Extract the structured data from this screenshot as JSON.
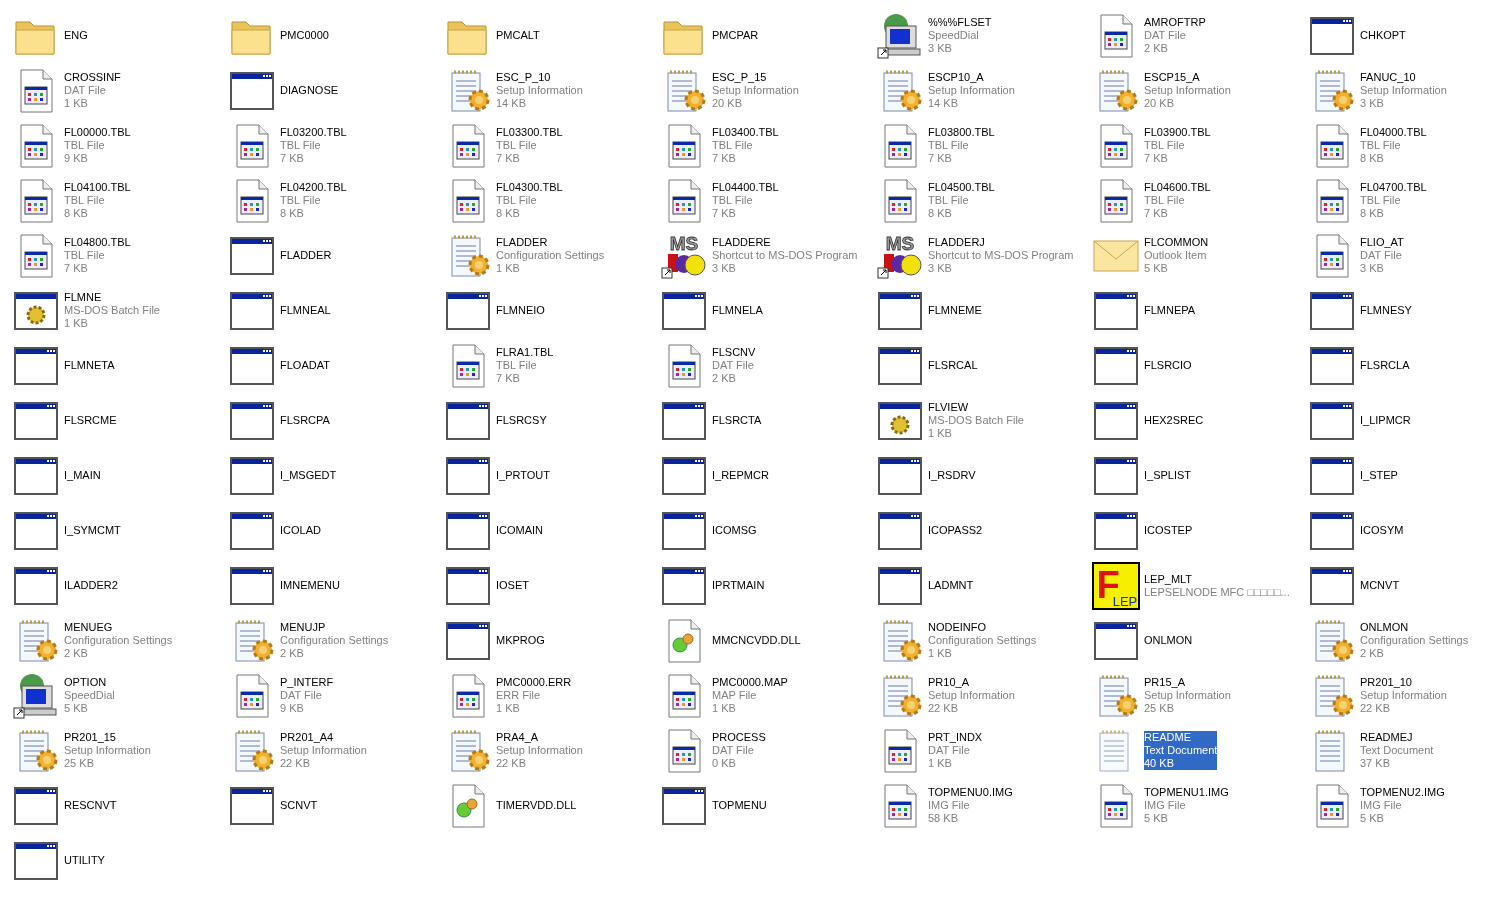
{
  "files": [
    {
      "name": "ENG",
      "kind": "folder",
      "selected": false
    },
    {
      "name": "PMC0000",
      "kind": "folder",
      "selected": false
    },
    {
      "name": "PMCALT",
      "kind": "folder",
      "selected": false
    },
    {
      "name": "PMCPAR",
      "kind": "folder",
      "selected": false
    },
    {
      "name": "%%%FLSET",
      "type": "SpeedDial",
      "size": "3 KB",
      "kind": "speeddial",
      "selected": false
    },
    {
      "name": "AMROFTRP",
      "type": "DAT File",
      "size": "2 KB",
      "kind": "datfile",
      "selected": false
    },
    {
      "name": "CHKOPT",
      "kind": "window",
      "selected": false
    },
    {
      "name": "CROSSINF",
      "type": "DAT File",
      "size": "1 KB",
      "kind": "datfile",
      "selected": false
    },
    {
      "name": "DIAGNOSE",
      "kind": "window",
      "selected": false
    },
    {
      "name": "ESC_P_10",
      "type": "Setup Information",
      "size": "14 KB",
      "kind": "setup",
      "selected": false
    },
    {
      "name": "ESC_P_15",
      "type": "Setup Information",
      "size": "20 KB",
      "kind": "setup",
      "selected": false
    },
    {
      "name": "ESCP10_A",
      "type": "Setup Information",
      "size": "14 KB",
      "kind": "setup",
      "selected": false
    },
    {
      "name": "ESCP15_A",
      "type": "Setup Information",
      "size": "20 KB",
      "kind": "setup",
      "selected": false
    },
    {
      "name": "FANUC_10",
      "type": "Setup Information",
      "size": "3 KB",
      "kind": "setup",
      "selected": false
    },
    {
      "name": "FL00000.TBL",
      "type": "TBL File",
      "size": "9 KB",
      "kind": "datfile",
      "selected": false
    },
    {
      "name": "FL03200.TBL",
      "type": "TBL File",
      "size": "7 KB",
      "kind": "datfile",
      "selected": false
    },
    {
      "name": "FL03300.TBL",
      "type": "TBL File",
      "size": "7 KB",
      "kind": "datfile",
      "selected": false
    },
    {
      "name": "FL03400.TBL",
      "type": "TBL File",
      "size": "7 KB",
      "kind": "datfile",
      "selected": false
    },
    {
      "name": "FL03800.TBL",
      "type": "TBL File",
      "size": "7 KB",
      "kind": "datfile",
      "selected": false
    },
    {
      "name": "FL03900.TBL",
      "type": "TBL File",
      "size": "7 KB",
      "kind": "datfile",
      "selected": false
    },
    {
      "name": "FL04000.TBL",
      "type": "TBL File",
      "size": "8 KB",
      "kind": "datfile",
      "selected": false
    },
    {
      "name": "FL04100.TBL",
      "type": "TBL File",
      "size": "8 KB",
      "kind": "datfile",
      "selected": false
    },
    {
      "name": "FL04200.TBL",
      "type": "TBL File",
      "size": "8 KB",
      "kind": "datfile",
      "selected": false
    },
    {
      "name": "FL04300.TBL",
      "type": "TBL File",
      "size": "8 KB",
      "kind": "datfile",
      "selected": false
    },
    {
      "name": "FL04400.TBL",
      "type": "TBL File",
      "size": "7 KB",
      "kind": "datfile",
      "selected": false
    },
    {
      "name": "FL04500.TBL",
      "type": "TBL File",
      "size": "8 KB",
      "kind": "datfile",
      "selected": false
    },
    {
      "name": "FL04600.TBL",
      "type": "TBL File",
      "size": "7 KB",
      "kind": "datfile",
      "selected": false
    },
    {
      "name": "FL04700.TBL",
      "type": "TBL File",
      "size": "8 KB",
      "kind": "datfile",
      "selected": false
    },
    {
      "name": "FL04800.TBL",
      "type": "TBL File",
      "size": "7 KB",
      "kind": "datfile",
      "selected": false
    },
    {
      "name": "FLADDER",
      "kind": "window",
      "selected": false
    },
    {
      "name": "FLADDER",
      "type": "Configuration Settings",
      "size": "1 KB",
      "kind": "setup",
      "selected": false
    },
    {
      "name": "FLADDERE",
      "type": "Shortcut to MS-DOS Program",
      "size": "3 KB",
      "kind": "msdos",
      "icon_text": [
        "MS"
      ],
      "selected": false
    },
    {
      "name": "FLADDERJ",
      "type": "Shortcut to MS-DOS Program",
      "size": "3 KB",
      "kind": "msdos",
      "icon_text": [
        "MS"
      ],
      "selected": false
    },
    {
      "name": "FLCOMMON",
      "type": "Outlook Item",
      "size": "5 KB",
      "kind": "outlook",
      "selected": false
    },
    {
      "name": "FLIO_AT",
      "type": "DAT File",
      "size": "3 KB",
      "kind": "datfile",
      "selected": false
    },
    {
      "name": "FLMNE",
      "type": "MS-DOS Batch File",
      "size": "1 KB",
      "kind": "batch",
      "selected": false
    },
    {
      "name": "FLMNEAL",
      "kind": "window",
      "selected": false
    },
    {
      "name": "FLMNEIO",
      "kind": "window",
      "selected": false
    },
    {
      "name": "FLMNELA",
      "kind": "window",
      "selected": false
    },
    {
      "name": "FLMNEME",
      "kind": "window",
      "selected": false
    },
    {
      "name": "FLMNEPA",
      "kind": "window",
      "selected": false
    },
    {
      "name": "FLMNESY",
      "kind": "window",
      "selected": false
    },
    {
      "name": "FLMNETA",
      "kind": "window",
      "selected": false
    },
    {
      "name": "FLOADAT",
      "kind": "window",
      "selected": false
    },
    {
      "name": "FLRA1.TBL",
      "type": "TBL File",
      "size": "7 KB",
      "kind": "datfile",
      "selected": false
    },
    {
      "name": "FLSCNV",
      "type": "DAT File",
      "size": "2 KB",
      "kind": "datfile",
      "selected": false
    },
    {
      "name": "FLSRCAL",
      "kind": "window",
      "selected": false
    },
    {
      "name": "FLSRCIO",
      "kind": "window",
      "selected": false
    },
    {
      "name": "FLSRCLA",
      "kind": "window",
      "selected": false
    },
    {
      "name": "FLSRCME",
      "kind": "window",
      "selected": false
    },
    {
      "name": "FLSRCPA",
      "kind": "window",
      "selected": false
    },
    {
      "name": "FLSRCSY",
      "kind": "window",
      "selected": false
    },
    {
      "name": "FLSRCTA",
      "kind": "window",
      "selected": false
    },
    {
      "name": "FLVIEW",
      "type": "MS-DOS Batch File",
      "size": "1 KB",
      "kind": "batch",
      "selected": false
    },
    {
      "name": "HEX2SREC",
      "kind": "window",
      "selected": false
    },
    {
      "name": "I_LIPMCR",
      "kind": "window",
      "selected": false
    },
    {
      "name": "I_MAIN",
      "kind": "window",
      "selected": false
    },
    {
      "name": "I_MSGEDT",
      "kind": "window",
      "selected": false
    },
    {
      "name": "I_PRTOUT",
      "kind": "window",
      "selected": false
    },
    {
      "name": "I_REPMCR",
      "kind": "window",
      "selected": false
    },
    {
      "name": "I_RSDRV",
      "kind": "window",
      "selected": false
    },
    {
      "name": "I_SPLIST",
      "kind": "window",
      "selected": false
    },
    {
      "name": "I_STEP",
      "kind": "window",
      "selected": false
    },
    {
      "name": "I_SYMCMT",
      "kind": "window",
      "selected": false
    },
    {
      "name": "ICOLAD",
      "kind": "window",
      "selected": false
    },
    {
      "name": "ICOMAIN",
      "kind": "window",
      "selected": false
    },
    {
      "name": "ICOMSG",
      "kind": "window",
      "selected": false
    },
    {
      "name": "ICOPASS2",
      "kind": "window",
      "selected": false
    },
    {
      "name": "ICOSTEP",
      "kind": "window",
      "selected": false
    },
    {
      "name": "ICOSYM",
      "kind": "window",
      "selected": false
    },
    {
      "name": "ILADDER2",
      "kind": "window",
      "selected": false
    },
    {
      "name": "IMNEMENU",
      "kind": "window",
      "selected": false
    },
    {
      "name": "IOSET",
      "kind": "window",
      "selected": false
    },
    {
      "name": "IPRTMAIN",
      "kind": "window",
      "selected": false
    },
    {
      "name": "LADMNT",
      "kind": "window",
      "selected": false
    },
    {
      "name": "LEP_MLT",
      "type": "LEPSELNODE MFC □□□□□...",
      "kind": "lep",
      "icon_text": [
        "F",
        "LEP"
      ],
      "selected": false
    },
    {
      "name": "MCNVT",
      "kind": "window",
      "selected": false
    },
    {
      "name": "MENUEG",
      "type": "Configuration Settings",
      "size": "2 KB",
      "kind": "setup",
      "selected": false
    },
    {
      "name": "MENUJP",
      "type": "Configuration Settings",
      "size": "2 KB",
      "kind": "setup",
      "selected": false
    },
    {
      "name": "MKPROG",
      "kind": "window",
      "selected": false
    },
    {
      "name": "MMCNCVDD.DLL",
      "kind": "dll",
      "selected": false
    },
    {
      "name": "NODEINFO",
      "type": "Configuration Settings",
      "size": "1 KB",
      "kind": "setup",
      "selected": false
    },
    {
      "name": "ONLMON",
      "kind": "window",
      "selected": false
    },
    {
      "name": "ONLMON",
      "type": "Configuration Settings",
      "size": "2 KB",
      "kind": "setup",
      "selected": false
    },
    {
      "name": "OPTION",
      "type": "SpeedDial",
      "size": "5 KB",
      "kind": "speeddial",
      "selected": false
    },
    {
      "name": "P_INTERF",
      "type": "DAT File",
      "size": "9 KB",
      "kind": "datfile",
      "selected": false
    },
    {
      "name": "PMC0000.ERR",
      "type": "ERR File",
      "size": "1 KB",
      "kind": "datfile",
      "selected": false
    },
    {
      "name": "PMC0000.MAP",
      "type": "MAP File",
      "size": "1 KB",
      "kind": "datfile",
      "selected": false
    },
    {
      "name": "PR10_A",
      "type": "Setup Information",
      "size": "22 KB",
      "kind": "setup",
      "selected": false
    },
    {
      "name": "PR15_A",
      "type": "Setup Information",
      "size": "25 KB",
      "kind": "setup",
      "selected": false
    },
    {
      "name": "PR201_10",
      "type": "Setup Information",
      "size": "22 KB",
      "kind": "setup",
      "selected": false
    },
    {
      "name": "PR201_15",
      "type": "Setup Information",
      "size": "25 KB",
      "kind": "setup",
      "selected": false
    },
    {
      "name": "PR201_A4",
      "type": "Setup Information",
      "size": "22 KB",
      "kind": "setup",
      "selected": false
    },
    {
      "name": "PRA4_A",
      "type": "Setup Information",
      "size": "22 KB",
      "kind": "setup",
      "selected": false
    },
    {
      "name": "PROCESS",
      "type": "DAT File",
      "size": "0 KB",
      "kind": "datfile",
      "selected": false
    },
    {
      "name": "PRT_INDX",
      "type": "DAT File",
      "size": "1 KB",
      "kind": "datfile",
      "selected": false
    },
    {
      "name": "README",
      "type": "Text Document",
      "size": "40 KB",
      "kind": "textdoc",
      "selected": true
    },
    {
      "name": "READMEJ",
      "type": "Text Document",
      "size": "37 KB",
      "kind": "textdoc",
      "selected": false
    },
    {
      "name": "RESCNVT",
      "kind": "window",
      "selected": false
    },
    {
      "name": "SCNVT",
      "kind": "window",
      "selected": false
    },
    {
      "name": "TIMERVDD.DLL",
      "kind": "dll",
      "selected": false
    },
    {
      "name": "TOPMENU",
      "kind": "window",
      "selected": false
    },
    {
      "name": "TOPMENU0.IMG",
      "type": "IMG File",
      "size": "58 KB",
      "kind": "datfile",
      "selected": false
    },
    {
      "name": "TOPMENU1.IMG",
      "type": "IMG File",
      "size": "5 KB",
      "kind": "datfile",
      "selected": false
    },
    {
      "name": "TOPMENU2.IMG",
      "type": "IMG File",
      "size": "5 KB",
      "kind": "datfile",
      "selected": false
    },
    {
      "name": "UTILITY",
      "kind": "window",
      "selected": false
    }
  ]
}
